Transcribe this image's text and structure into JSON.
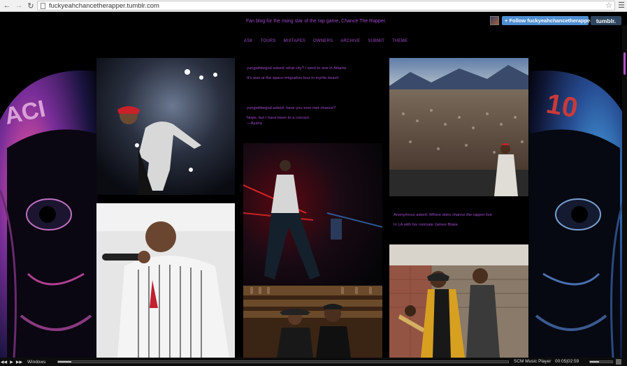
{
  "browser": {
    "url": "fuckyeahchancetherapper.tumblr.com",
    "back_icon": "back-arrow-icon",
    "forward_icon": "forward-arrow-icon",
    "reload_icon": "reload-icon"
  },
  "blog": {
    "tagline": "Fan blog for the rising star of the rap game, Chance The Rapper.",
    "nav": [
      "ASK",
      "TOURS",
      "MIXTAPES",
      "OWNERS",
      "ARCHIVE",
      "SUBMIT",
      "THEME"
    ]
  },
  "tumblr_bar": {
    "follow_label": "+ Follow fuckyeahchancetherapper",
    "brand": "tumblr."
  },
  "posts": {
    "text1": {
      "question": "yungwhitegod asked: what city? I went to one in Atlanta",
      "answer": "It's was at the space imigration tour in myrtle beach"
    },
    "text2": {
      "question": "yungwhitegod asked: have you ever met chance?",
      "answer_line1": "Nope, but I have been to a concert.",
      "answer_line2": "---Aysha"
    },
    "text3": {
      "question": "Anonymous asked: Where does chance the rapper live",
      "answer": "In LA with his roomate James Blake"
    }
  },
  "player": {
    "windows_label": "Windows",
    "name": "SCM Music Player",
    "time": "00:05|02:59",
    "progress": 0.03,
    "volume": 0.4
  },
  "colors": {
    "accent": "#9f47c8",
    "follow_blue": "#4f8fd3",
    "tumblr_navy": "#2f4660"
  }
}
